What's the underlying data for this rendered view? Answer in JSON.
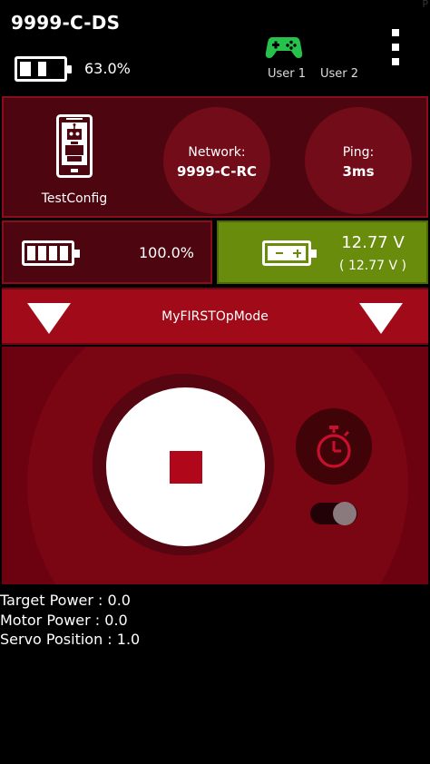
{
  "header": {
    "driver_station_name": "9999-C-DS",
    "corner_mark": "P",
    "phone_battery_percent": "63.0%",
    "phone_battery_level": 0.63,
    "gamepad_icon": "gamepad-icon",
    "gamepad_color": "#27c24c",
    "users": [
      "User 1",
      "User 2"
    ],
    "menu_icon": "overflow-menu-icon"
  },
  "status": {
    "robot_icon": "robot-controller-phone-icon",
    "config_name": "TestConfig",
    "network_label": "Network:",
    "network_value": "9999-C-RC",
    "ping_label": "Ping:",
    "ping_value": "3ms"
  },
  "battery": {
    "rc_battery_percent": "100.0%",
    "rc_battery_level": 1.0,
    "robot_voltage": "12.77 V",
    "robot_voltage_min": "( 12.77 V )",
    "voltage_panel_color": "#6a8c0c"
  },
  "opmode": {
    "selected": "MyFIRSTOpMode",
    "left_selector_icon": "dropdown-triangle-icon",
    "right_selector_icon": "dropdown-triangle-icon"
  },
  "control": {
    "stop_icon": "stop-icon",
    "timer_icon": "stopwatch-icon",
    "accent_color": "#b0081a",
    "timer_toggle_on": true
  },
  "telemetry": [
    "Target Power : 0.0",
    "Motor Power : 0.0",
    "Servo Position : 1.0"
  ]
}
